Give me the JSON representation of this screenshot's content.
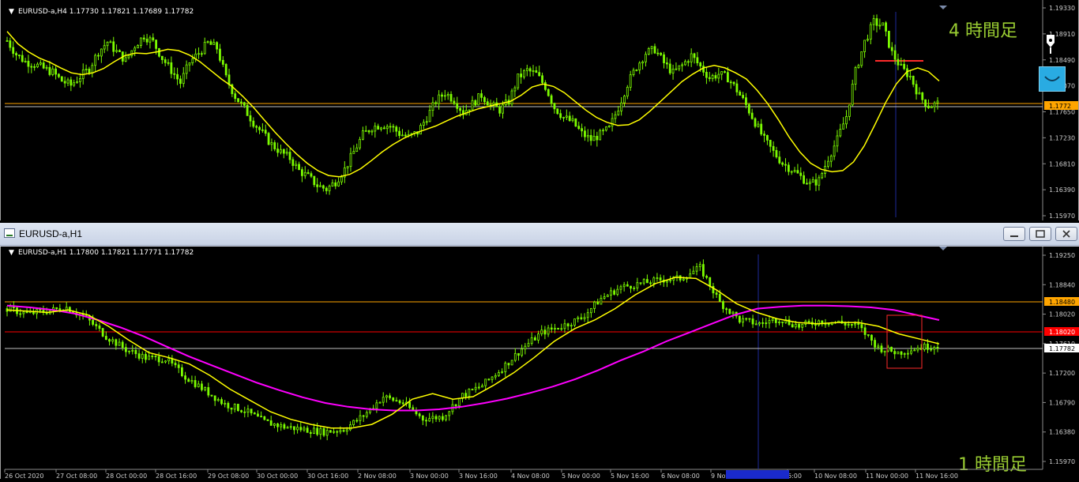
{
  "charts": {
    "h4": {
      "header": "EURUSD-a,H4  1.17730 1.17821 1.17689 1.17782",
      "tf_label": "4 時間足",
      "price_ticks": [
        "1.19330",
        "1.18910",
        "1.18490",
        "1.18070",
        "1.17650",
        "1.17230",
        "1.16810",
        "1.16390",
        "1.15970"
      ],
      "current_price": "1.17782",
      "current_price_badge": "1.1772"
    },
    "h1": {
      "window_title": "EURUSD-a,H1",
      "header": "EURUSD-a,H1  1.17800 1.17821 1.17771 1.17782",
      "tf_label": "1 時間足",
      "price_ticks": [
        "1.19250",
        "1.18840",
        "1.18020",
        "1.17610",
        "1.17200",
        "1.16790",
        "1.16380",
        "1.15970"
      ],
      "level_orange": "1.18480",
      "level_red": "1.18020",
      "current_price": "1.17782",
      "time_labels": [
        "26 Oct 2020",
        "27 Oct 08:00",
        "28 Oct 00:00",
        "28 Oct 16:00",
        "29 Oct 08:00",
        "30 Oct 00:00",
        "30 Oct 16:00",
        "2 Nov 08:00",
        "3 Nov 00:00",
        "3 Nov 16:00",
        "4 Nov 08:00",
        "5 Nov 00:00",
        "5 Nov 16:00",
        "6 Nov 08:00",
        "9 Nov",
        "6:00",
        "10 Nov 08:00",
        "11 Nov 00:00",
        "11 Nov 16:00"
      ]
    }
  },
  "chart_data": [
    {
      "type": "line",
      "title": "",
      "series": [
        {
          "color": "#7cfc00",
          "values": [
            1.188,
            1.1858,
            1.1846,
            1.1842,
            1.1835,
            1.1829,
            1.1815,
            1.1808,
            1.1822,
            1.1835,
            1.1862,
            1.1878,
            1.1862,
            1.1848,
            1.1872,
            1.1888,
            1.1878,
            1.1852,
            1.1832,
            1.1812,
            1.1845,
            1.186,
            1.1876,
            1.1868,
            1.182,
            1.179,
            1.177,
            1.1748,
            1.173,
            1.1712,
            1.17,
            1.169,
            1.167,
            1.166,
            1.1646,
            1.164,
            1.1652,
            1.1672,
            1.17,
            1.1728,
            1.174,
            1.1744,
            1.1742,
            1.173,
            1.1724,
            1.1732,
            1.1756,
            1.1782,
            1.1796,
            1.1784,
            1.1764,
            1.1778,
            1.1792,
            1.1776,
            1.1768,
            1.1782,
            1.182,
            1.1832,
            1.1826,
            1.1806,
            1.1772,
            1.1756,
            1.1748,
            1.173,
            1.172,
            1.1728,
            1.1738,
            1.1772,
            1.181,
            1.1838,
            1.186,
            1.1866,
            1.1844,
            1.1828,
            1.184,
            1.1856,
            1.1838,
            1.182,
            1.1826,
            1.182,
            1.18,
            1.1776,
            1.1748,
            1.172,
            1.17,
            1.1682,
            1.1672,
            1.166,
            1.1648,
            1.1654,
            1.169,
            1.172,
            1.1758,
            1.183,
            1.1878,
            1.191,
            1.1904,
            1.186,
            1.1836,
            1.1822,
            1.179,
            1.1775,
            1.1778
          ]
        },
        {
          "color": "#ffff00",
          "values": [
            1.1895,
            1.1875,
            1.1862,
            1.1852,
            1.1845,
            1.1836,
            1.1828,
            1.1825,
            1.1828,
            1.1835,
            1.1846,
            1.1856,
            1.186,
            1.1859,
            1.1862,
            1.1866,
            1.1864,
            1.1857,
            1.1846,
            1.1832,
            1.1818,
            1.1806,
            1.179,
            1.1772,
            1.1752,
            1.1732,
            1.1714,
            1.1697,
            1.1682,
            1.167,
            1.1662,
            1.166,
            1.1664,
            1.1673,
            1.1686,
            1.17,
            1.1712,
            1.1722,
            1.173,
            1.1736,
            1.1742,
            1.175,
            1.1758,
            1.1764,
            1.177,
            1.1774,
            1.1778,
            1.1782,
            1.1792,
            1.1805,
            1.181,
            1.1806,
            1.1796,
            1.1782,
            1.1768,
            1.1756,
            1.1748,
            1.1743,
            1.1744,
            1.1752,
            1.1766,
            1.1782,
            1.1798,
            1.1814,
            1.1826,
            1.1836,
            1.184,
            1.1836,
            1.1828,
            1.1818,
            1.18,
            1.1778,
            1.1752,
            1.1724,
            1.17,
            1.1682,
            1.1672,
            1.1668,
            1.167,
            1.1684,
            1.171,
            1.1744,
            1.178,
            1.181,
            1.183,
            1.1836,
            1.183,
            1.1815
          ]
        }
      ],
      "ylim": [
        1.1597,
        1.1933
      ],
      "annotations": [
        {
          "text": "4 時間足"
        }
      ],
      "grid": false
    },
    {
      "type": "line",
      "title": "",
      "categories": [
        "26 Oct 2020",
        "27 Oct 08:00",
        "28 Oct 00:00",
        "28 Oct 16:00",
        "29 Oct 08:00",
        "30 Oct 00:00",
        "30 Oct 16:00",
        "2 Nov 08:00",
        "3 Nov 00:00",
        "3 Nov 16:00",
        "4 Nov 08:00",
        "5 Nov 00:00",
        "5 Nov 16:00",
        "6 Nov 08:00",
        "9 Nov",
        "6:00",
        "10 Nov 08:00",
        "11 Nov 00:00",
        "11 Nov 16:00"
      ],
      "series": [
        {
          "color": "#7cfc00",
          "values": [
            1.184,
            1.1832,
            1.1836,
            1.1842,
            1.1825,
            1.1796,
            1.1775,
            1.1762,
            1.176,
            1.1732,
            1.171,
            1.1688,
            1.1678,
            1.166,
            1.1652,
            1.1648,
            1.1644,
            1.1648,
            1.167,
            1.17,
            1.169,
            1.1665,
            1.1668,
            1.1702,
            1.1718,
            1.1745,
            1.1776,
            1.1802,
            1.1812,
            1.1825,
            1.1856,
            1.1874,
            1.188,
            1.1886,
            1.1888,
            1.1905,
            1.185,
            1.1822,
            1.1816,
            1.1824,
            1.1812,
            1.182,
            1.1818,
            1.1812,
            1.1778,
            1.177,
            1.1778,
            1.1782
          ]
        },
        {
          "color": "#ffff00",
          "values": [
            1.1838,
            1.1836,
            1.1834,
            1.1838,
            1.183,
            1.1812,
            1.179,
            1.177,
            1.1762,
            1.1752,
            1.1734,
            1.1712,
            1.1694,
            1.1676,
            1.1664,
            1.1656,
            1.165,
            1.165,
            1.1656,
            1.1672,
            1.1696,
            1.1705,
            1.1696,
            1.17,
            1.1718,
            1.1738,
            1.1762,
            1.1788,
            1.1808,
            1.1822,
            1.184,
            1.1862,
            1.188,
            1.189,
            1.1888,
            1.187,
            1.1848,
            1.1834,
            1.1824,
            1.1818,
            1.1816,
            1.1818,
            1.1818,
            1.1812,
            1.18,
            1.1792,
            1.1784
          ]
        },
        {
          "color": "#ff00ff",
          "values": [
            1.1845,
            1.1842,
            1.1838,
            1.1832,
            1.1822,
            1.181,
            1.1796,
            1.178,
            1.1764,
            1.175,
            1.1736,
            1.1722,
            1.171,
            1.1699,
            1.169,
            1.1684,
            1.168,
            1.1678,
            1.1678,
            1.168,
            1.1684,
            1.169,
            1.1697,
            1.1706,
            1.1716,
            1.1728,
            1.1742,
            1.1758,
            1.1772,
            1.1788,
            1.1802,
            1.1816,
            1.183,
            1.184,
            1.1843,
            1.1845,
            1.1845,
            1.1844,
            1.1842,
            1.1838,
            1.183,
            1.1822
          ]
        }
      ],
      "ylim": [
        1.1597,
        1.1925
      ],
      "levels": [
        {
          "value": 1.1848,
          "color": "#ffa500"
        },
        {
          "value": 1.1802,
          "color": "#ff0000"
        },
        {
          "value": 1.17782,
          "color": "#c0c0c0"
        }
      ],
      "annotations": [
        {
          "text": "1 時間足"
        }
      ],
      "grid": false
    }
  ],
  "colors": {
    "candle": "#7cfc00",
    "ma_fast": "#ffff00",
    "ma_slow": "#ff00ff",
    "level_orange": "#ffa500",
    "level_red": "#ff0000",
    "label_green": "#9acd32"
  }
}
